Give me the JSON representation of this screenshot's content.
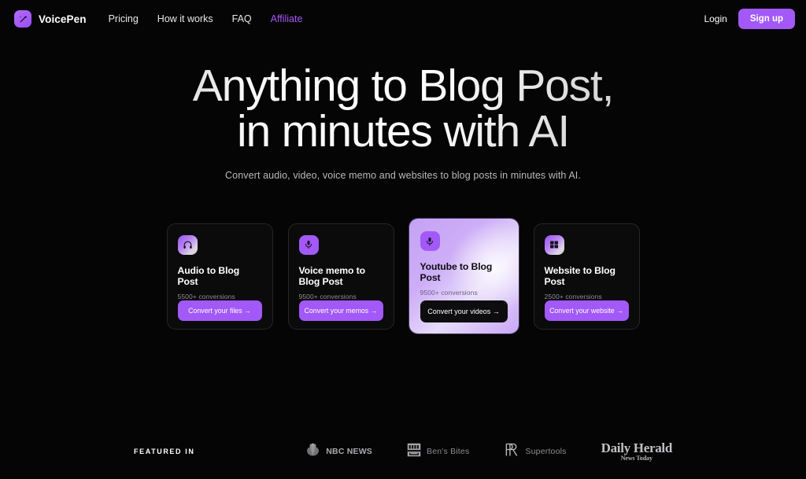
{
  "brand": {
    "name": "VoicePen",
    "logo_icon": "magic-wand-icon",
    "accent_color": "#a855f7"
  },
  "nav": {
    "links": [
      {
        "label": "Pricing",
        "accent": false
      },
      {
        "label": "How it works",
        "accent": false
      },
      {
        "label": "FAQ",
        "accent": false
      },
      {
        "label": "Affiliate",
        "accent": true
      }
    ],
    "login_label": "Login",
    "signup_label": "Sign up"
  },
  "hero": {
    "title_line1": "Anything to Blog Post,",
    "title_line2": "in minutes with AI",
    "subtitle": "Convert audio, video, voice memo and websites to blog posts in minutes with AI."
  },
  "cards": [
    {
      "icon": "headphones-icon",
      "title": "Audio to Blog Post",
      "conversions": "5500+ conversions",
      "cta": "Convert your files →",
      "featured": false
    },
    {
      "icon": "microphone-icon",
      "title": "Voice memo to Blog Post",
      "conversions": "9500+ conversions",
      "cta": "Convert your memos →",
      "featured": false
    },
    {
      "icon": "microphone-icon",
      "title": "Youtube to Blog Post",
      "conversions": "9500+ conversions",
      "cta": "Convert your videos →",
      "featured": true
    },
    {
      "icon": "window-grid-icon",
      "title": "Website to Blog Post",
      "conversions": "2500+ conversions",
      "cta": "Convert your website →",
      "featured": false
    }
  ],
  "featured_in": {
    "label": "FEATURED IN",
    "logos": [
      {
        "name": "NBC NEWS",
        "icon": "nbc-peacock-icon"
      },
      {
        "name": "Ben's Bites",
        "icon": "bens-bites-icon"
      },
      {
        "name": "Supertools",
        "icon": "supertools-monogram-icon"
      },
      {
        "name": "Daily Herald",
        "tagline": "News Today",
        "icon": "daily-herald-wordmark"
      }
    ]
  }
}
